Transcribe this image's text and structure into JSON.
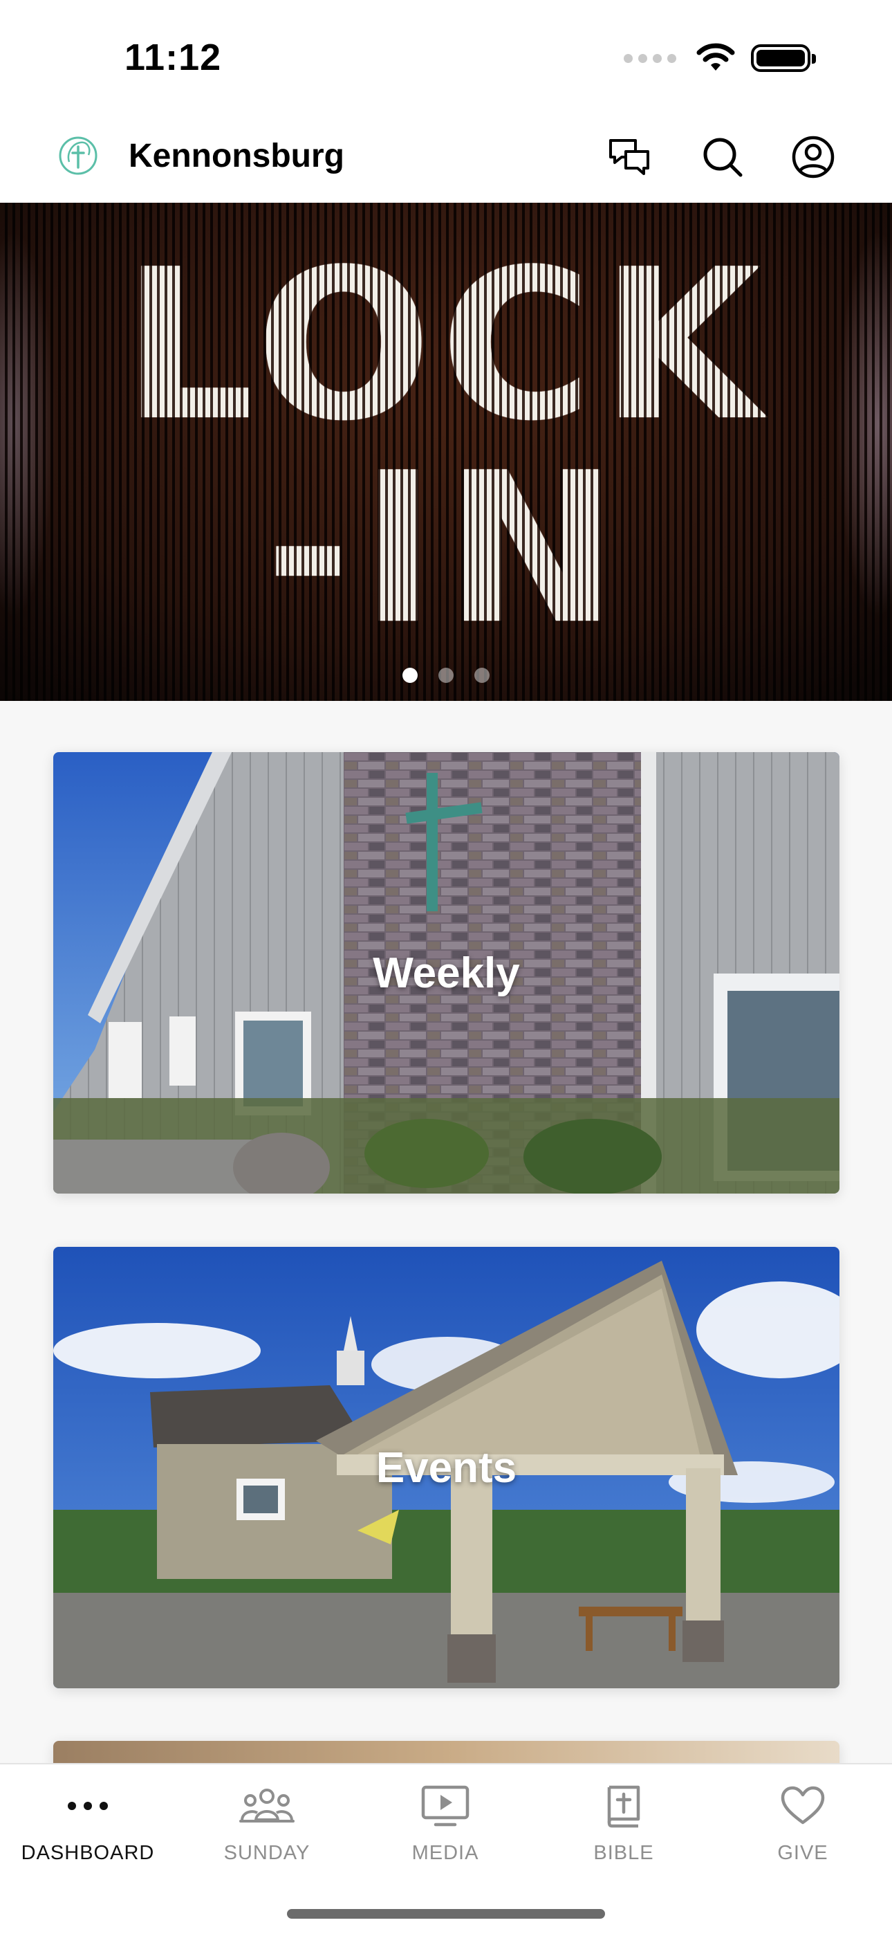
{
  "status_bar": {
    "time": "11:12"
  },
  "header": {
    "title": "Kennonsburg",
    "icons": [
      "logo-icon",
      "chat-icon",
      "search-icon",
      "profile-icon"
    ]
  },
  "hero": {
    "line1": "LOCK",
    "line2": "-IN",
    "slide_count": 3,
    "active_slide": 1
  },
  "cards": [
    {
      "label": "Weekly"
    },
    {
      "label": "Events"
    }
  ],
  "bottom_nav": {
    "active_index": 0,
    "active_color": "#111111",
    "inactive_color": "#8e8e8e",
    "items": [
      {
        "label": "DASHBOARD",
        "icon": "more-dots-icon"
      },
      {
        "label": "SUNDAY",
        "icon": "people-icon"
      },
      {
        "label": "MEDIA",
        "icon": "play-screen-icon"
      },
      {
        "label": "BIBLE",
        "icon": "bible-icon"
      },
      {
        "label": "GIVE",
        "icon": "heart-icon"
      }
    ]
  },
  "colors": {
    "brand_accent": "#5bbfa8"
  }
}
